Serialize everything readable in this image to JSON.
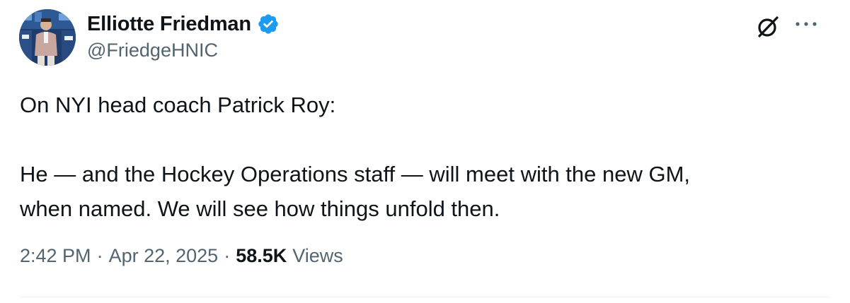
{
  "author": {
    "display_name": "Elliotte Friedman",
    "handle": "@FriedgeHNIC",
    "verified_icon": "verified-badge-icon",
    "verified_color": "#1d9bf0"
  },
  "actions": {
    "grok_icon": "grok-icon",
    "more_icon": "more-dots-icon"
  },
  "tweet": {
    "lines": [
      "On NYI head coach Patrick Roy:",
      "He — and the Hockey Operations staff — will meet with the new GM,",
      "when named. We will see how things unfold then."
    ]
  },
  "meta": {
    "time": "2:42 PM",
    "separator": "·",
    "date": "Apr 22, 2025",
    "views_count": "58.5K",
    "views_label": "Views"
  },
  "colors": {
    "text_primary": "#0f1419",
    "text_secondary": "#536471",
    "divider": "#eff3f4"
  }
}
